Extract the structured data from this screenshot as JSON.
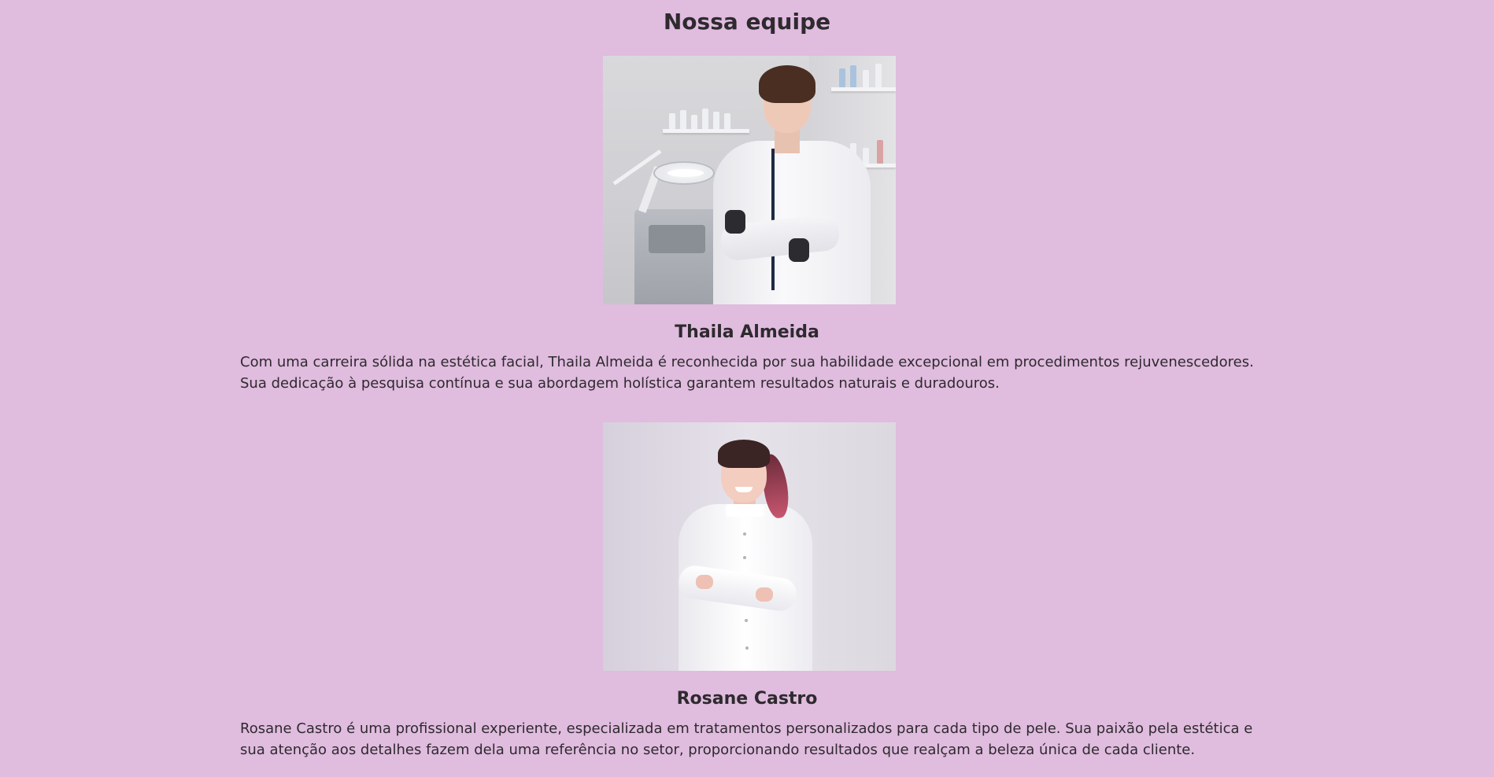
{
  "page": {
    "title": "Nossa equipe",
    "background_color": "#e0bcdf",
    "text_color": "#2e2a2e"
  },
  "team": [
    {
      "name": "Thaila Almeida",
      "bio_lines": [
        "Com uma carreira sólida na estética facial, Thaila Almeida é reconhecida por sua habilidade excepcional em procedimentos rejuvenescedores.",
        "Sua dedicação à pesquisa contínua e sua abordagem holística garantem resultados naturais e duradouros."
      ]
    },
    {
      "name": "Rosane Castro",
      "bio_lines": [
        "Rosane Castro é uma profissional experiente, especializada em tratamentos personalizados para cada tipo de pele. Sua paixão pela estética e",
        "sua atenção aos detalhes fazem dela uma referência no setor, proporcionando resultados que realçam a beleza única de cada cliente."
      ]
    }
  ]
}
